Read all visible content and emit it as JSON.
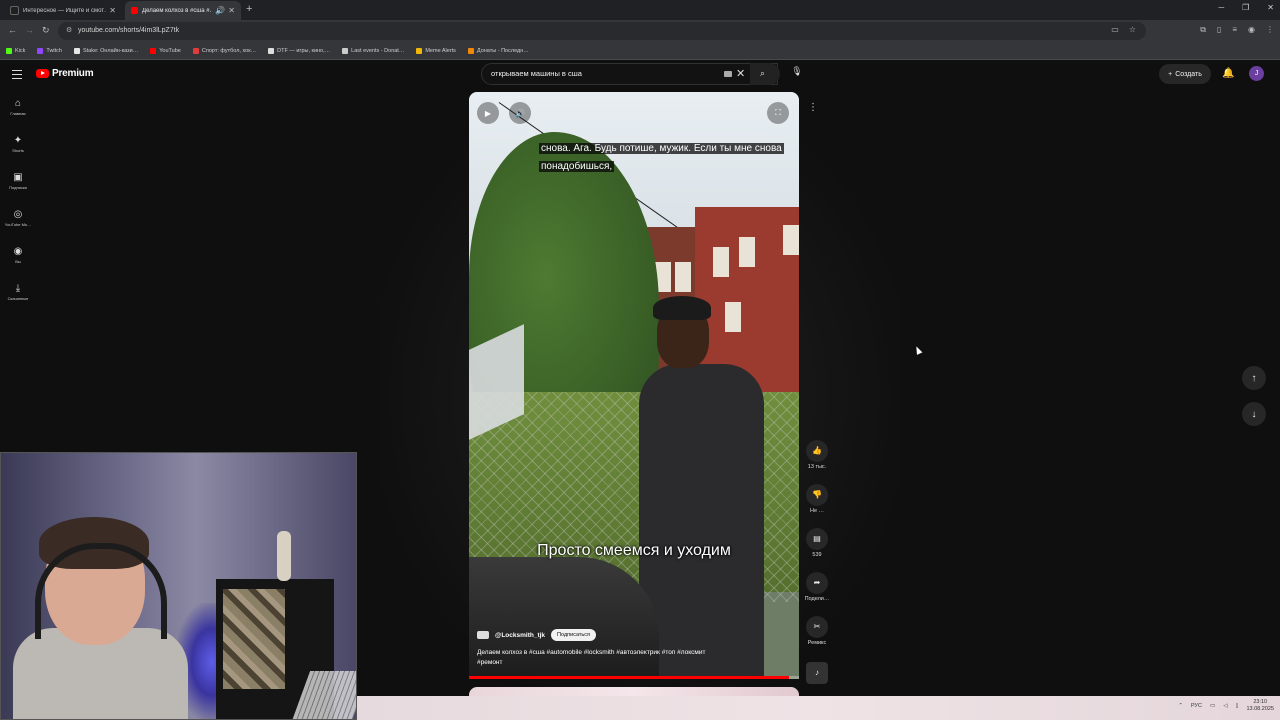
{
  "browser": {
    "tabs": [
      {
        "title": "Интересное — Ищите и смот…",
        "favicon_color": "#202020",
        "active": false
      },
      {
        "title": "Делаем колхоз в #сша #…",
        "favicon_color": "#ff0000",
        "active": true
      }
    ],
    "url": "youtube.com/shorts/4im3lLpZ7tk",
    "bookmarks": [
      {
        "label": "Kick",
        "color": "#53fc18"
      },
      {
        "label": "Twitch",
        "color": "#9146ff"
      },
      {
        "label": "Stake: Онлайн-кази…",
        "color": "#e6e6e6"
      },
      {
        "label": "YouTube",
        "color": "#ff0000"
      },
      {
        "label": "Спорт: футбол, хок…",
        "color": "#e23b3b"
      },
      {
        "label": "DTF — игры, кино,…",
        "color": "#dddddd"
      },
      {
        "label": "Last events - Donat…",
        "color": "#cccccc"
      },
      {
        "label": "Meme Alerts",
        "color": "#f2b705"
      },
      {
        "label": "Донаты - Последн…",
        "color": "#f28705"
      }
    ]
  },
  "header": {
    "logo_text": "Premium",
    "search_value": "открываем машины в сша",
    "create_label": "Создать",
    "avatar_letter": "J"
  },
  "guide": [
    {
      "icon": "home-icon",
      "label": "Главная"
    },
    {
      "icon": "shorts-icon",
      "label": "Shorts"
    },
    {
      "icon": "subscriptions-icon",
      "label": "Подписки"
    },
    {
      "icon": "music-icon",
      "label": "YouTube Mu…"
    },
    {
      "icon": "you-icon",
      "label": "Вы"
    },
    {
      "icon": "downloads-icon",
      "label": "Скачанные"
    }
  ],
  "video": {
    "captions": "снова.  Ага.  Будь потише, мужик.  Если ты мне снова понадобишься,",
    "subtitle": "Просто смеемся и уходим",
    "channel": "@Locksmith_tjk",
    "subscribe_label": "Подписаться",
    "description": "Делаем колхоз в #сша #automobile #locksmith #автоэлектрик #топ #локсмит #ремонт",
    "progress": 0.97
  },
  "actions": [
    {
      "icon": "thumbs-up-icon",
      "label": "13 тыс."
    },
    {
      "icon": "thumbs-down-icon",
      "label": "Не …"
    },
    {
      "icon": "comments-icon",
      "label": "539"
    },
    {
      "icon": "share-icon",
      "label": "Подели…"
    },
    {
      "icon": "remix-icon",
      "label": "Ремикс"
    }
  ],
  "taskbar": {
    "lang": "РУС",
    "time": "23:10",
    "date": "13.08.2025"
  }
}
